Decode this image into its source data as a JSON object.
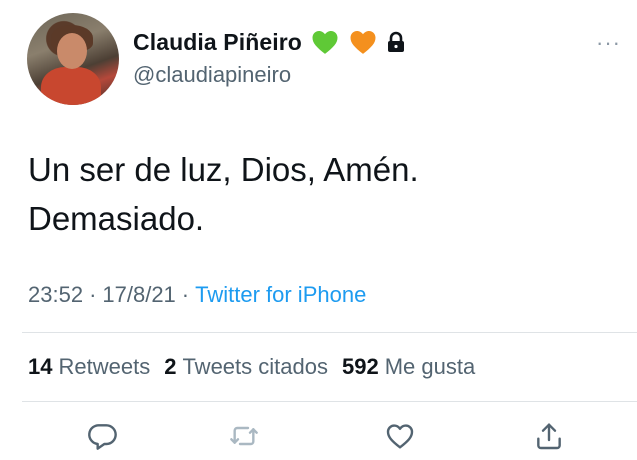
{
  "user": {
    "display_name": "Claudia Piñeiro",
    "handle": "@claudiapineiro",
    "badges": [
      "green-heart",
      "orange-heart",
      "lock-icon"
    ]
  },
  "tweet": {
    "line1": "Un ser de luz, Dios, Amén.",
    "line2": "Demasiado."
  },
  "meta": {
    "time": "23:52",
    "separator": "·",
    "date": "17/8/21",
    "source": "Twitter for iPhone"
  },
  "stats": {
    "retweets_count": "14",
    "retweets_label": "Retweets",
    "quotes_count": "2",
    "quotes_label": "Tweets citados",
    "likes_count": "592",
    "likes_label": "Me gusta"
  },
  "more_label": "···",
  "colors": {
    "green_heart": "#5fc936",
    "orange_heart": "#f4901e",
    "link": "#1d9bf0",
    "secondary_text": "#536471"
  },
  "actions": [
    "reply-icon",
    "retweet-icon",
    "like-icon",
    "share-icon"
  ]
}
